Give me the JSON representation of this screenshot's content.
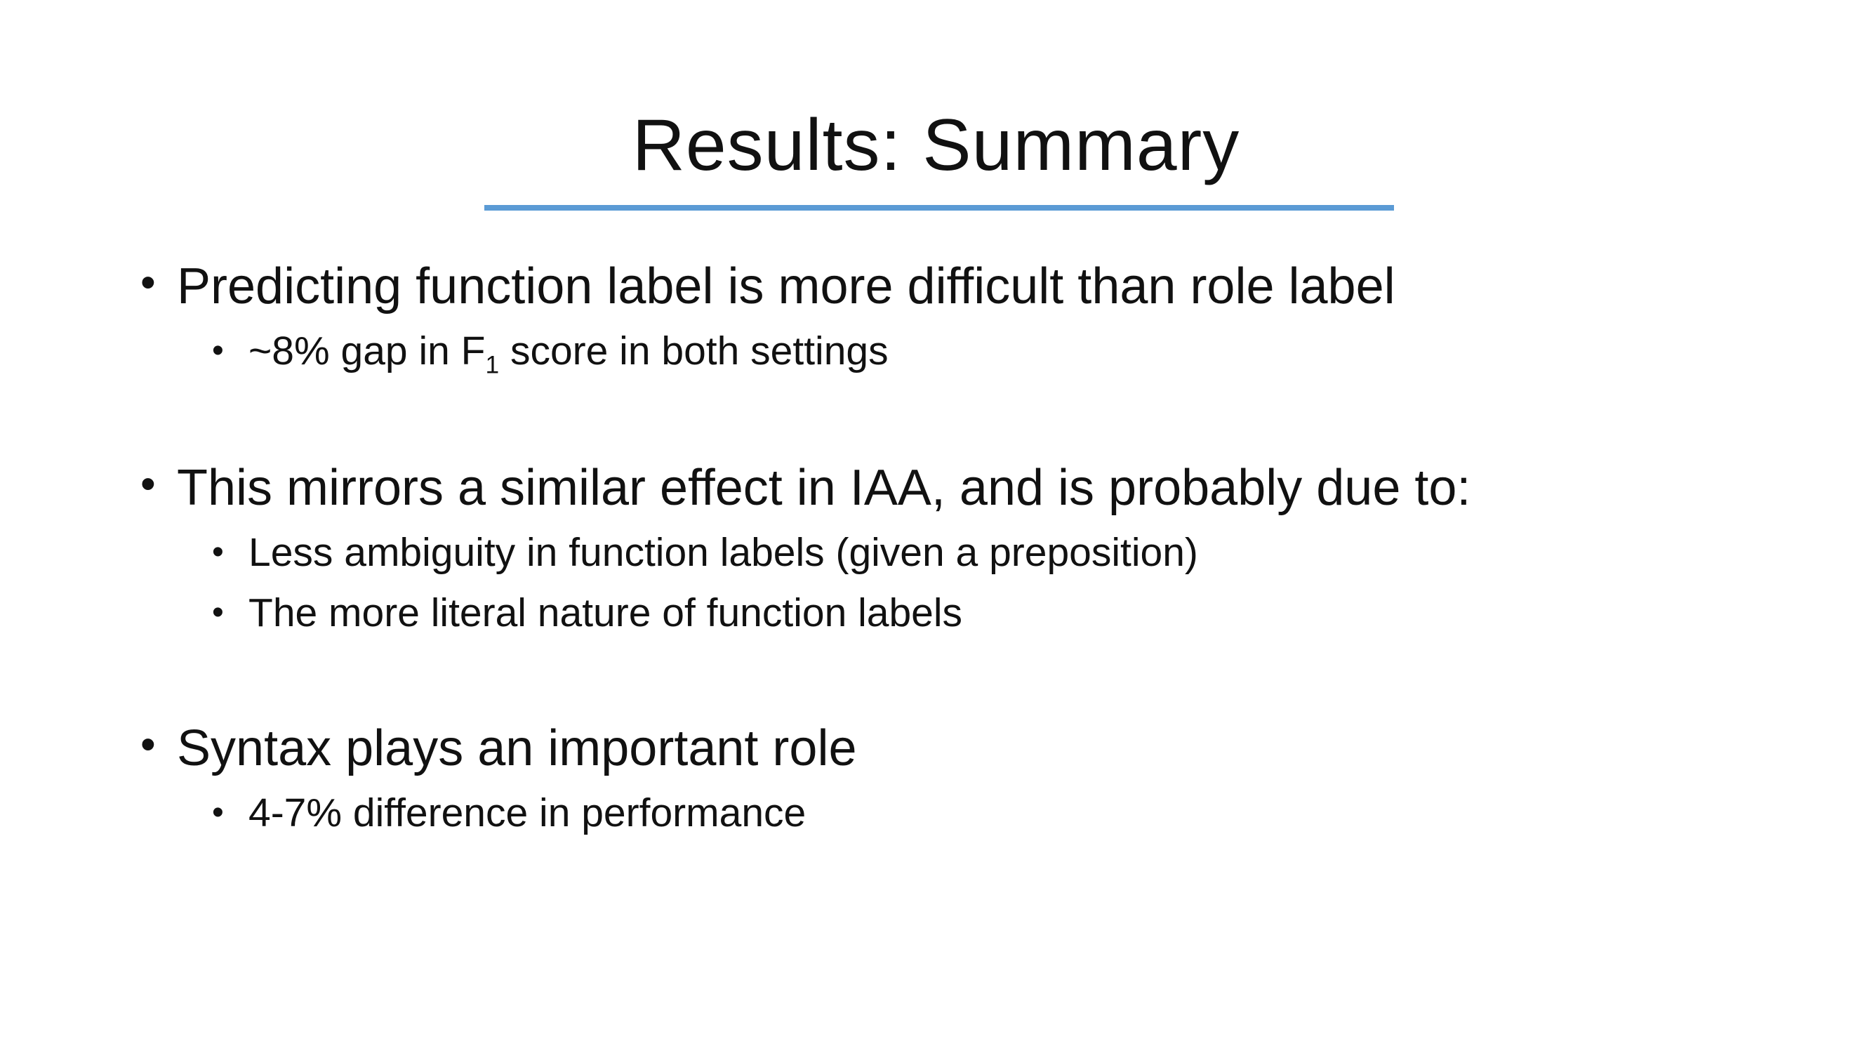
{
  "slide": {
    "title": "Results: Summary",
    "accent_color": "#5b9bd5",
    "bullet_icon": "bullet-dot",
    "groups": [
      {
        "text": "Predicting function label is more difficult than role label",
        "sub": [
          {
            "pre": "~8% gap in F",
            "subscript": "1",
            "post": " score in both settings"
          }
        ]
      },
      {
        "text": "This mirrors a similar effect in IAA, and is probably due to:",
        "sub": [
          {
            "text": "Less ambiguity in function labels (given a preposition)"
          },
          {
            "text": "The more literal nature of function labels"
          }
        ]
      },
      {
        "text": "Syntax plays an important role",
        "sub": [
          {
            "text": "4-7% difference in performance"
          }
        ]
      }
    ]
  }
}
